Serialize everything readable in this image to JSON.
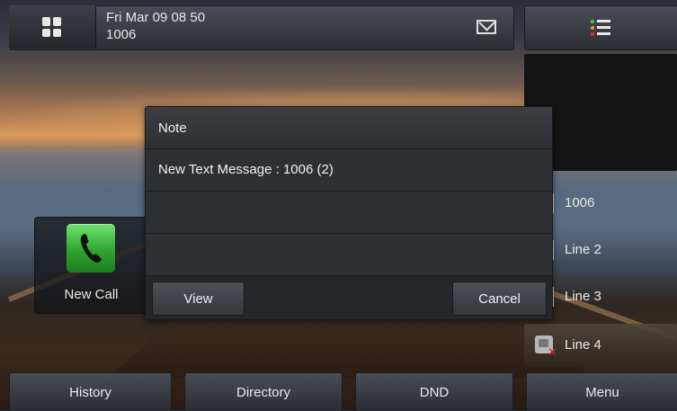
{
  "status_bar": {
    "datetime": "Fri Mar 09 08 50",
    "account": "1006",
    "icons": [
      "apps-grid-icon",
      "mail-icon"
    ]
  },
  "menu_icon": "list-menu-icon",
  "colors": {
    "menu_dot_top": "#3ecf3e",
    "menu_dot_mid": "#f0a020",
    "menu_dot_bottom": "#e03030",
    "new_call_green": "#2fa52f",
    "error_red": "#e02020"
  },
  "line_keys": [
    {
      "label": "1006"
    },
    {
      "label": "Line 2"
    },
    {
      "label": "Line 3"
    },
    {
      "label": "Line 4",
      "icon": "phone-error-icon"
    }
  ],
  "new_call": {
    "label": "New Call",
    "icon": "phone-handset-icon"
  },
  "dialog": {
    "title": "Note",
    "message": "New Text Message : 1006 (2)",
    "buttons": {
      "view": "View",
      "cancel": "Cancel"
    }
  },
  "softkeys": [
    "History",
    "Directory",
    "DND",
    "Menu"
  ]
}
